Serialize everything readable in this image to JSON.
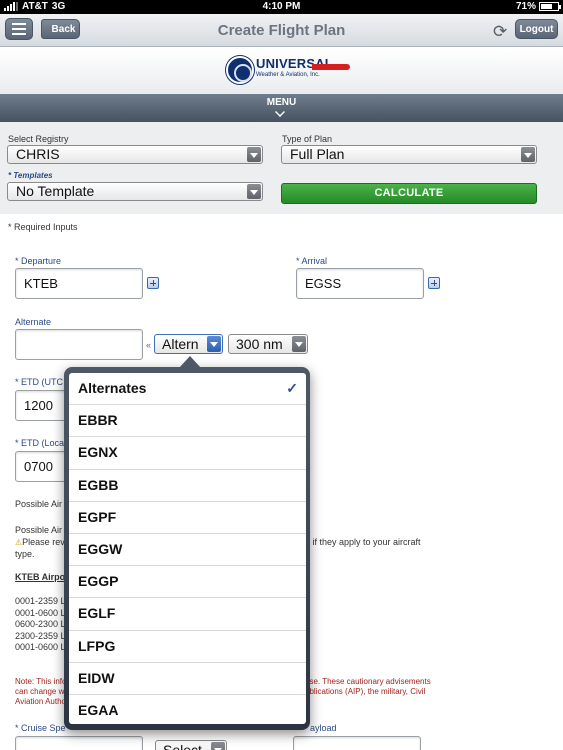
{
  "status_bar": {
    "carrier": "AT&T",
    "network": "3G",
    "time": "4:10 PM",
    "battery": "71%",
    "battery_level": 0.71
  },
  "nav": {
    "title": "Create Flight Plan",
    "back_label": "Back",
    "logout_label": "Logout"
  },
  "logo": {
    "name": "UNIVERSAL",
    "tagline": "Weather & Aviation, Inc."
  },
  "menu": {
    "label": "MENU"
  },
  "top_form": {
    "registry_label": "Select Registry",
    "registry_value": "CHRIS",
    "plan_type_label": "Type of Plan",
    "plan_type_value": "Full Plan",
    "templates_label": "* Templates",
    "template_value": "No Template",
    "calculate_label": "CALCULATE"
  },
  "required_note": "* Required Inputs",
  "route": {
    "departure_label": "* Departure",
    "departure_value": "KTEB",
    "arrival_label": "* Arrival",
    "arrival_value": "EGSS",
    "alternate_label": "Alternate",
    "alternate_value": "",
    "alternate_arrow": "«",
    "alternate_select": "Altern",
    "radius_select": "300 nm"
  },
  "times": {
    "etd_utc_label": "* ETD (UTC",
    "etd_utc_value": "1200",
    "etd_local_label": "* ETD (Loca",
    "etd_local_value": "0700"
  },
  "partial_text": {
    "possible_1": "Possible Air",
    "possible_2": "Possible Air",
    "please_review": "Please rev",
    "review_tail": "d if they apply to your aircraft",
    "type_word": "type.",
    "airport_heading": "KTEB Airpo",
    "hours": [
      "0001-2359 L",
      "0001-0600 L",
      "0600-2300 L",
      "2300-2359 L",
      "0001-0600 L"
    ],
    "note_line1_start": "Note: This info",
    "note_line1_end": "ase. These cautionary advisements",
    "note_line2_start": "can change wi",
    "note_line2_end": "ublications (AIP), the military, Civil",
    "note_line3_start": "Aviation Autho"
  },
  "bottom": {
    "cruise_label": "* Cruise Spe",
    "select_label": "Select",
    "payload_label": "ayload"
  },
  "popover": {
    "items": [
      {
        "label": "Alternates",
        "checked": true
      },
      {
        "label": "EBBR",
        "checked": false
      },
      {
        "label": "EGNX",
        "checked": false
      },
      {
        "label": "EGBB",
        "checked": false
      },
      {
        "label": "EGPF",
        "checked": false
      },
      {
        "label": "EGGW",
        "checked": false
      },
      {
        "label": "EGGP",
        "checked": false
      },
      {
        "label": "EGLF",
        "checked": false
      },
      {
        "label": "LFPG",
        "checked": false
      },
      {
        "label": "EIDW",
        "checked": false
      },
      {
        "label": "EGAA",
        "checked": false
      }
    ],
    "check_glyph": "✓"
  }
}
